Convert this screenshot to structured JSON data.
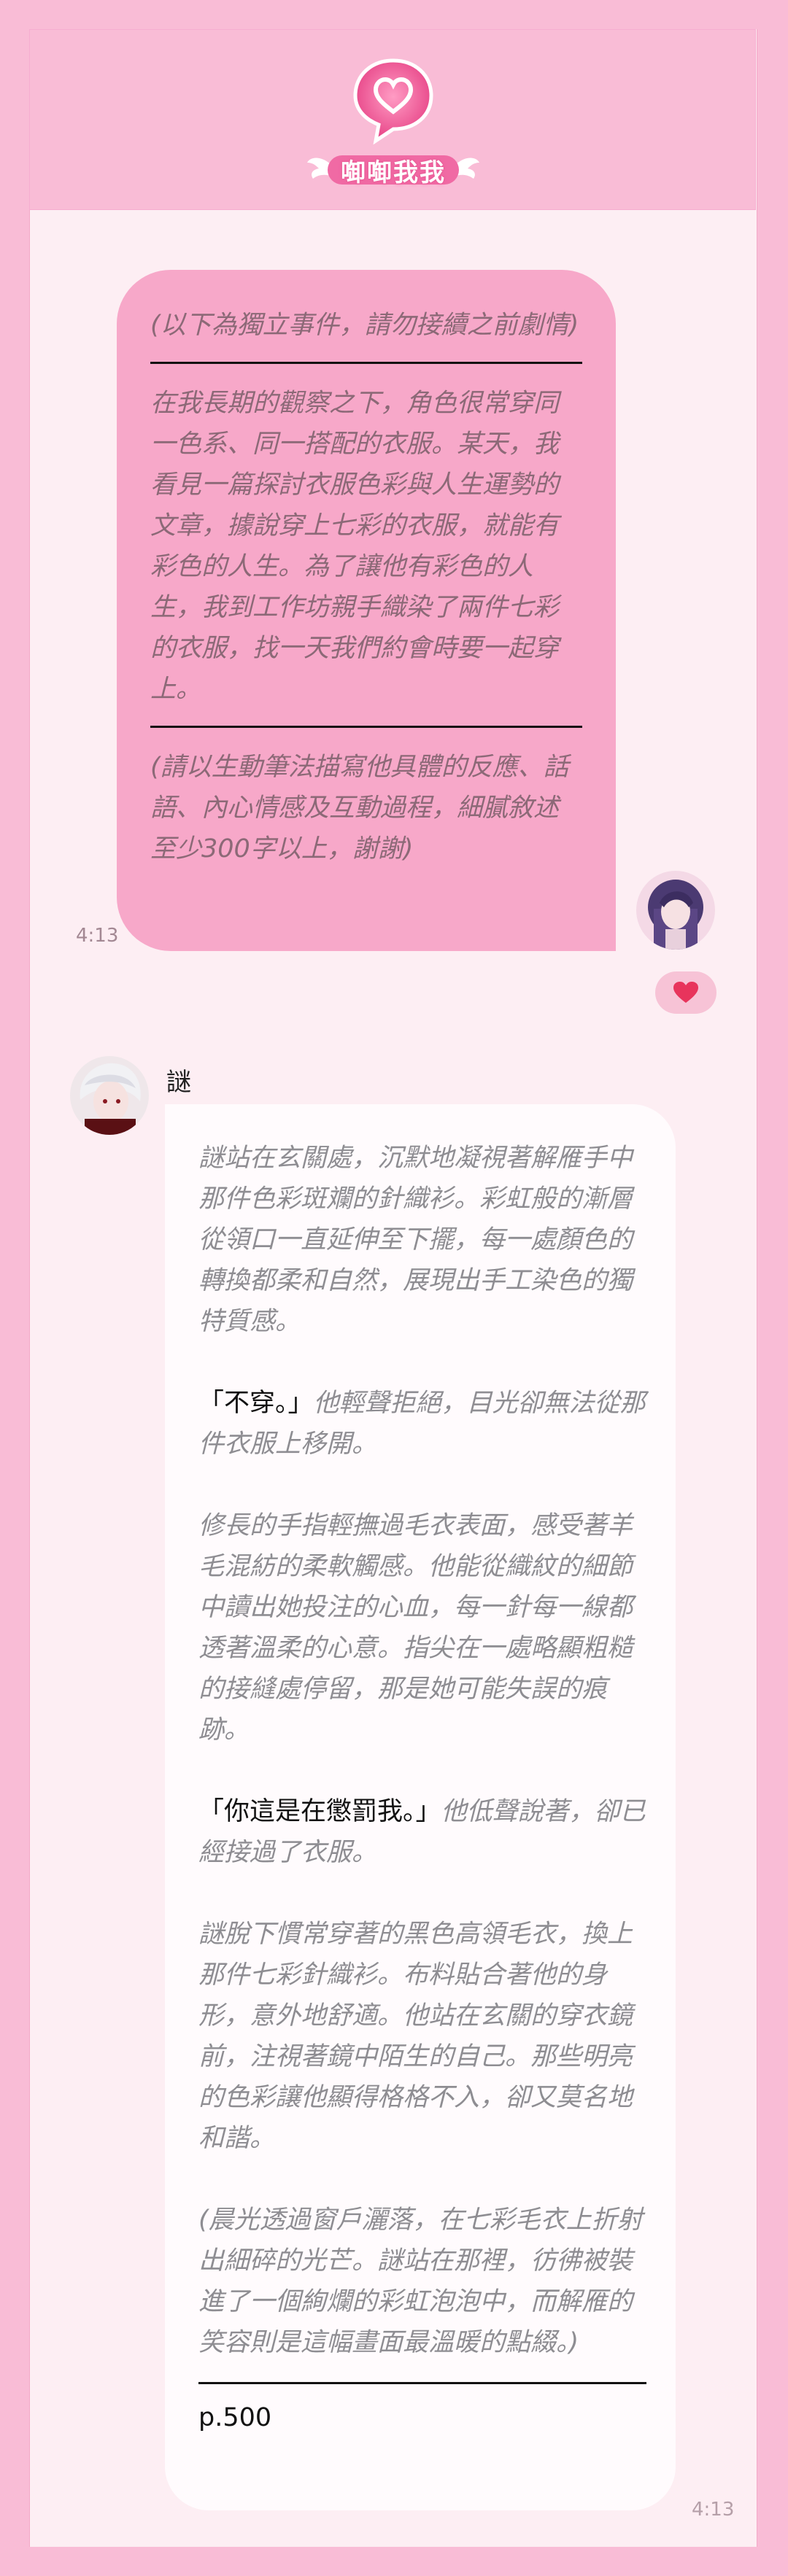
{
  "app": {
    "logo_text": "啣啣我我",
    "colors": {
      "accent": "#f7a8c9",
      "background": "#fdeef3",
      "frame": "#f9bcd6"
    }
  },
  "user_message": {
    "intro": "(以下為獨立事件，請勿接續之前劇情)",
    "body": "在我長期的觀察之下，角色很常穿同一色系、同一搭配的衣服。某天，我看見一篇探討衣服色彩與人生運勢的文章，據說穿上七彩的衣服，就能有彩色的人生。為了讓他有彩色的人生，我到工作坊親手織染了兩件七彩的衣服，找一天我們約會時要一起穿上。",
    "request": "(請以生動筆法描寫他具體的反應、話語、內心情感及互動過程，細膩敘述至少300字以上，謝謝)",
    "time": "4:13"
  },
  "reaction": {
    "icon": "heart-icon"
  },
  "bot_message": {
    "name": "謎",
    "p1": "謎站在玄關處，沉默地凝視著解雁手中那件色彩斑斕的針織衫。彩虹般的漸層從領口一直延伸至下擺，每一處顏色的轉換都柔和自然，展現出手工染色的獨特質感。",
    "p2_speech": "「不穿。」",
    "p2_rest": "他輕聲拒絕，目光卻無法從那件衣服上移開。",
    "p3": "修長的手指輕撫過毛衣表面，感受著羊毛混紡的柔軟觸感。他能從織紋的細節中讀出她投注的心血，每一針每一線都透著溫柔的心意。指尖在一處略顯粗糙的接縫處停留，那是她可能失誤的痕跡。",
    "p4_speech": "「你這是在懲罰我。」",
    "p4_rest": "他低聲說著，卻已經接過了衣服。",
    "p5": "謎脫下慣常穿著的黑色高領毛衣，換上那件七彩針織衫。布料貼合著他的身形，意外地舒適。他站在玄關的穿衣鏡前，注視著鏡中陌生的自己。那些明亮的色彩讓他顯得格格不入，卻又莫名地和諧。",
    "p6": "(晨光透過窗戶灑落，在七彩毛衣上折射出細碎的光芒。謎站在那裡，彷彿被裝進了一個絢爛的彩虹泡泡中，而解雁的笑容則是這幅畫面最溫暖的點綴。)",
    "page": "p.500",
    "time": "4:13"
  }
}
